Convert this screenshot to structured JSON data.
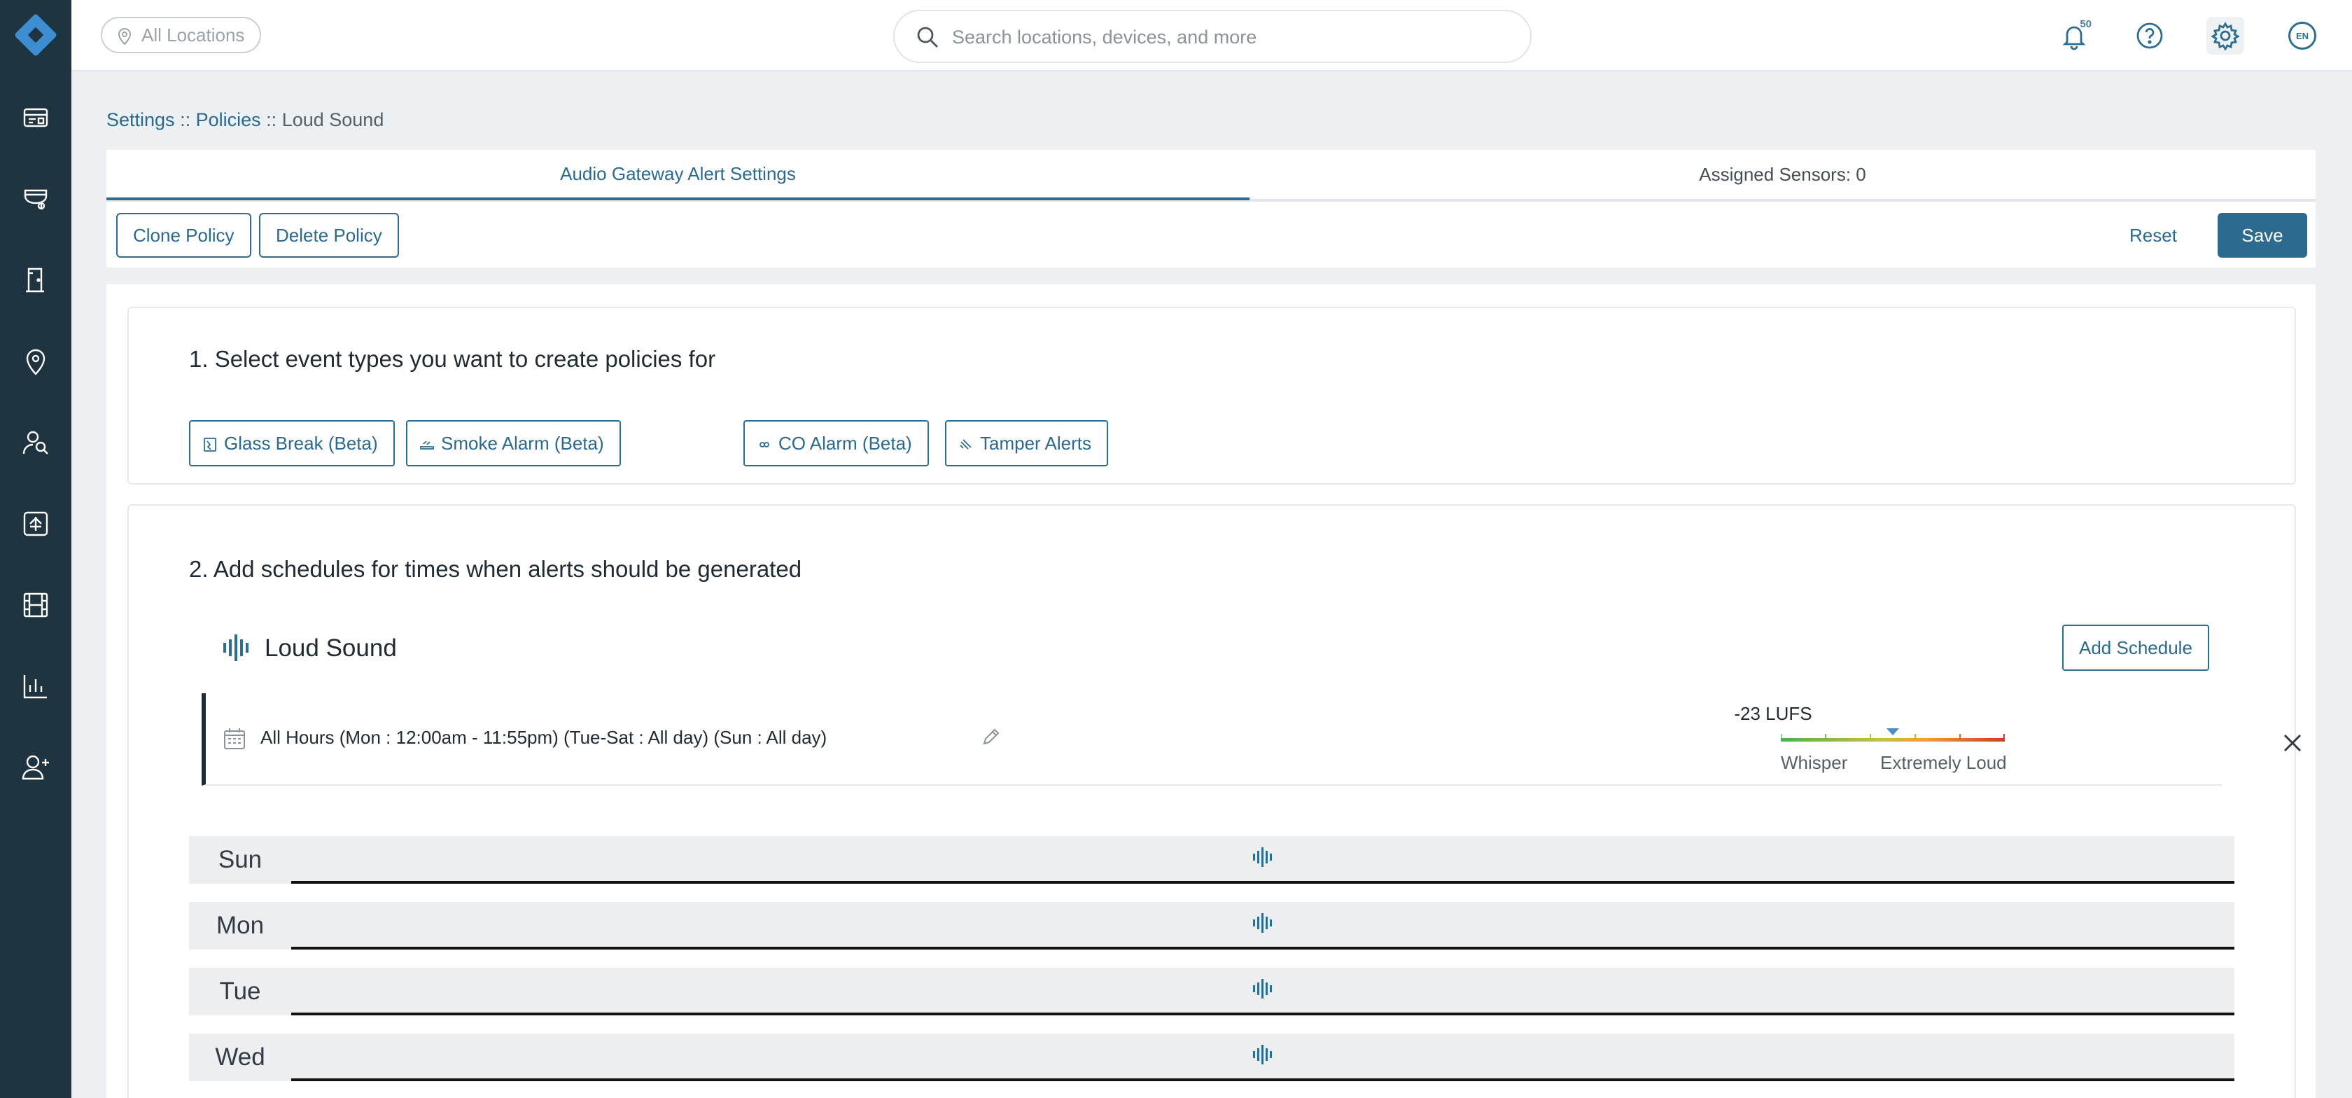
{
  "topbar": {
    "location_pill": "All Locations",
    "search_placeholder": "Search locations, devices, and more",
    "notification_count": "50",
    "language": "EN"
  },
  "sidebar": {
    "items": [
      "dashboard-icon",
      "cameras-icon",
      "access-icon",
      "locations-icon",
      "search-people-icon",
      "alerts-icon",
      "video-icon",
      "reports-icon",
      "users-icon"
    ]
  },
  "breadcrumb": {
    "settings": "Settings",
    "sep": "::",
    "policies": "Policies",
    "current": "Loud Sound"
  },
  "tabs": [
    {
      "label": "Audio Gateway Alert Settings",
      "active": true
    },
    {
      "label": "Assigned Sensors: 0",
      "active": false
    }
  ],
  "actions": {
    "clone": "Clone Policy",
    "delete": "Delete Policy",
    "reset": "Reset",
    "save": "Save"
  },
  "section1": {
    "title": "1. Select event types you want to create policies for",
    "chips": [
      "Glass Break (Beta)",
      "Smoke Alarm (Beta)",
      "CO Alarm (Beta)",
      "Tamper Alerts"
    ]
  },
  "section2": {
    "title": "2. Add schedules for times when alerts should be generated",
    "event_title": "Loud Sound",
    "add_schedule": "Add Schedule",
    "schedule": {
      "text": "All Hours (Mon : 12:00am - 11:55pm) (Tue-Sat : All day) (Sun : All day)",
      "level_label": "-23 LUFS",
      "level_fraction": 0.5,
      "low_label": "Whisper",
      "high_label": "Extremely Loud"
    },
    "days": [
      "Sun",
      "Mon",
      "Tue",
      "Wed"
    ]
  },
  "colors": {
    "sidebar_bg": "#1e3440",
    "accent": "#2c6e91",
    "primary_button": "#2c6a8f"
  }
}
